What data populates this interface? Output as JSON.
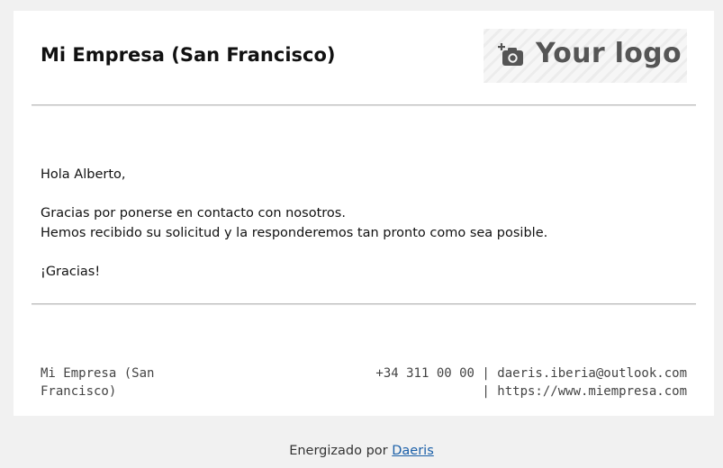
{
  "header": {
    "company_name": "Mi Empresa (San Francisco)",
    "logo_text": "Your logo"
  },
  "message": {
    "greeting": "Hola Alberto,",
    "line1": "Gracias por ponerse en contacto con nosotros.",
    "line2": "Hemos recibido su solicitud y la responderemos tan pronto como sea posible.",
    "closing": "¡Gracias!"
  },
  "footer": {
    "company_name": "Mi Empresa (San Francisco)",
    "phone": "+34 311 00 00",
    "separator": "|",
    "email": "daeris.iberia@outlook.com",
    "website": "https://www.miempresa.com"
  },
  "powered_by": {
    "prefix": "Energizado por",
    "link_text": "Daeris"
  },
  "colors": {
    "background": "#f1f1f1",
    "card": "#ffffff",
    "link": "#1a5fa8"
  }
}
